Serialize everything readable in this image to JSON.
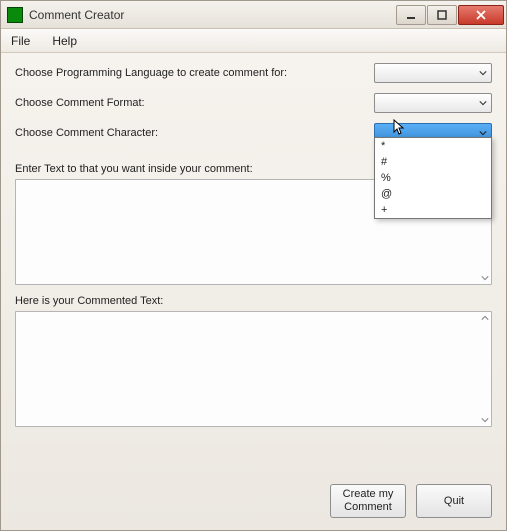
{
  "window": {
    "title": "Comment Creator"
  },
  "menu": {
    "file": "File",
    "help": "Help"
  },
  "labels": {
    "lang": "Choose Programming Language to create comment for:",
    "format": "Choose Comment Format:",
    "char": "Choose Comment Character:",
    "input": "Enter Text to that you want inside your comment:",
    "output": "Here is your Commented Text:"
  },
  "dropdown": {
    "options": [
      "*",
      "#",
      "%",
      "@",
      "+"
    ]
  },
  "buttons": {
    "create": "Create my\nComment",
    "quit": "Quit"
  }
}
